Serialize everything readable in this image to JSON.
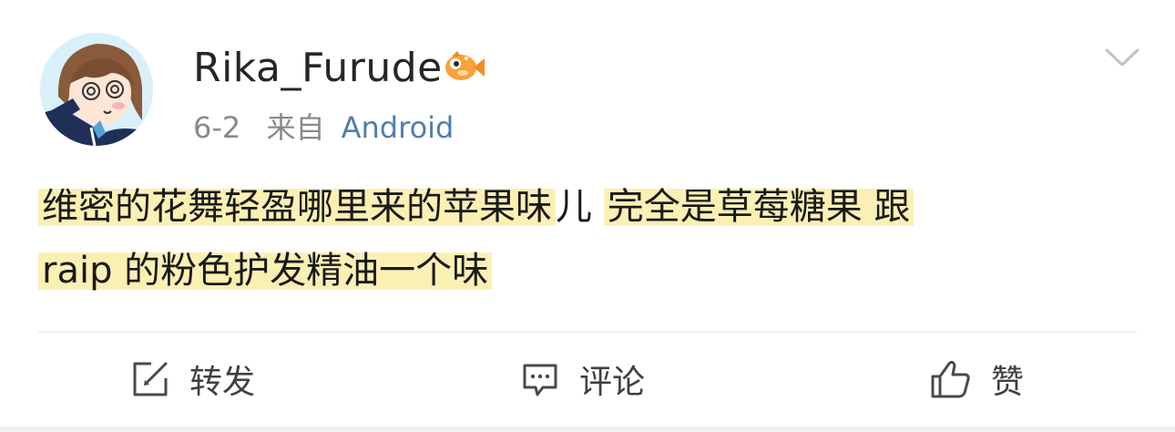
{
  "post": {
    "username": "Rika_Furude",
    "date": "6-2",
    "from_label": "来自",
    "source": "Android",
    "content_parts": [
      "维密的花舞轻盈哪里来的苹果味",
      "儿 ",
      "完全是草莓糖果 跟",
      "raip 的粉色护发精油一个味"
    ]
  },
  "actions": {
    "repost_label": "转发",
    "comment_label": "评论",
    "like_label": "赞"
  },
  "colors": {
    "source_link": "#507daf",
    "highlight": "#fbf0b4",
    "meta_text": "#8a8a8a"
  },
  "icons": [
    "fish-badge-icon",
    "chevron-down-icon",
    "repost-icon",
    "comment-icon",
    "like-icon"
  ]
}
